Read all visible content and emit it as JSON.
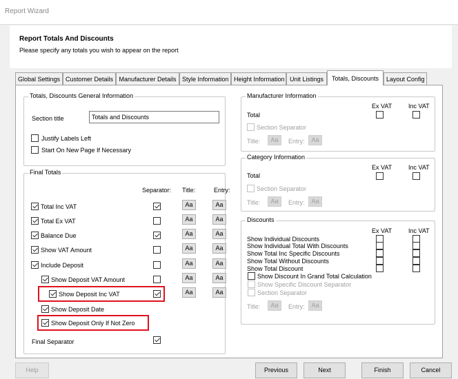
{
  "window": {
    "title": "Report Wizard"
  },
  "header": {
    "title": "Report Totals And Discounts",
    "subtitle": "Please specify any totals you wish to appear on the report"
  },
  "tabs": [
    "Global Settings",
    "Customer Details",
    "Manufacturer Details",
    "Style Information",
    "Height Information",
    "Unit Listings",
    "Totals, Discounts",
    "Layout Config"
  ],
  "general": {
    "group_title": "Totals, Discounts General Information",
    "section_title_label": "Section title",
    "section_title_value": "Totals and Discounts",
    "justify_labels": "Justify Labels Left",
    "start_new_page": "Start On New Page If Necessary"
  },
  "final_totals": {
    "group_title": "Final Totals",
    "col_separator": "Separator:",
    "col_title": "Title:",
    "col_entry": "Entry:",
    "aa": "Aa",
    "rows": [
      {
        "label": "Total Inc VAT",
        "checked": true,
        "separator": true
      },
      {
        "label": "Total Ex VAT",
        "checked": true,
        "separator": false
      },
      {
        "label": "Balance Due",
        "checked": true,
        "separator": true
      },
      {
        "label": "Show VAT Amount",
        "checked": true,
        "separator": false
      },
      {
        "label": "Include Deposit",
        "checked": true,
        "separator": false
      },
      {
        "label": "Show Deposit VAT Amount",
        "checked": true,
        "separator": false
      },
      {
        "label": "Show Deposit Inc VAT",
        "checked": true,
        "separator": true
      },
      {
        "label": "Show Deposit Date",
        "checked": true
      },
      {
        "label": "Show Deposit Only If Not Zero",
        "checked": true
      }
    ],
    "final_separator": "Final Separator"
  },
  "manufacturer": {
    "group_title": "Manufacturer Information",
    "ex_vat": "Ex VAT",
    "inc_vat": "Inc VAT",
    "total": "Total",
    "section_separator": "Section Separator",
    "title": "Title:",
    "entry": "Entry:",
    "aa": "Aa"
  },
  "category": {
    "group_title": "Category Information",
    "ex_vat": "Ex VAT",
    "inc_vat": "Inc VAT",
    "total": "Total",
    "section_separator": "Section Separator",
    "title": "Title:",
    "entry": "Entry:",
    "aa": "Aa"
  },
  "discounts": {
    "group_title": "Discounts",
    "ex_vat": "Ex VAT",
    "inc_vat": "Inc VAT",
    "rows": [
      "Show Individual Discounts",
      "Show Individual Total With Discounts",
      "Show Total Inc Specific Discounts",
      "Show Total Without Discounts",
      "Show Total Discount"
    ],
    "grand_total": "Show Discount In Grand Total Calculation",
    "specific_separator": "Show Specific Discount Separator",
    "section_separator": "Section Separator",
    "title": "Title:",
    "entry": "Entry:",
    "aa": "Aa"
  },
  "footer": {
    "help": "Help",
    "previous": "Previous",
    "next": "Next",
    "finish": "Finish",
    "cancel": "Cancel"
  },
  "colors": {
    "highlight": "#e0101e"
  }
}
